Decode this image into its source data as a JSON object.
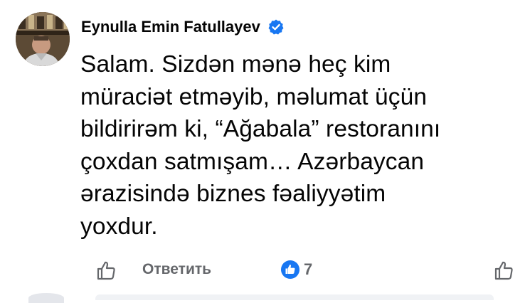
{
  "comment": {
    "author_name": "Eynulla Emin Fatullayev",
    "verified": true,
    "text": "Salam. Sizdən mənə heç kim\nmüraciət etməyib, məlumat üçün\nbildirirəm ki, “Ağabala” restoranını\nçoxdan satmışam… Azərbaycan\nərazisində biznes fəaliyyətim\nyoxdur.",
    "reply_label": "Ответить",
    "reaction_count": "7"
  },
  "colors": {
    "text": "#050505",
    "secondary": "#65676b",
    "accent_blue": "#1877f2"
  },
  "icons": {
    "verified": "verified-badge-icon",
    "like_action": "thumbs-up-outline-icon",
    "reaction": "like-reaction-icon",
    "like_right": "thumbs-up-outline-icon"
  }
}
